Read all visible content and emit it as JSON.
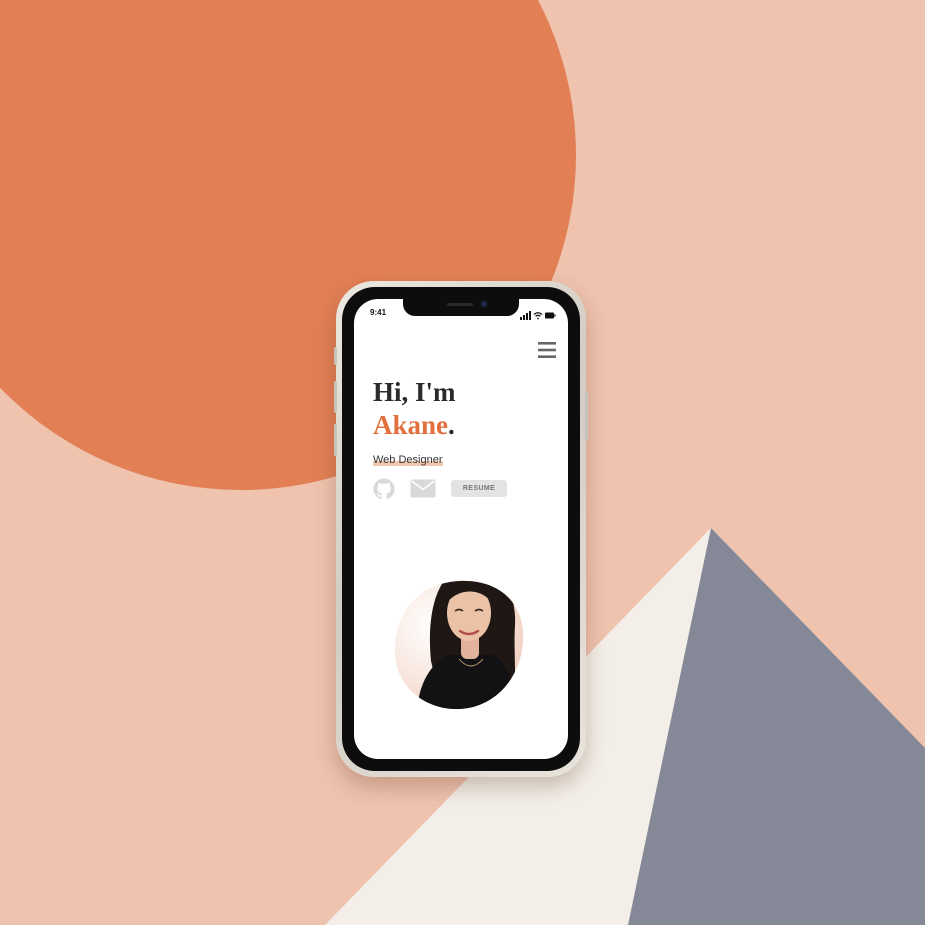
{
  "colors": {
    "background": "#efc3ae",
    "circle": "#e27f55",
    "cream_triangle": "#f3efe8",
    "slate_triangle": "#858896",
    "accent": "#e2703f",
    "heading": "#2b2b2b"
  },
  "status_bar": {
    "time": "9:41"
  },
  "menu": {
    "icon": "hamburger-menu-icon"
  },
  "hero": {
    "greeting": "Hi, I'm",
    "name": "Akane",
    "name_period": ".",
    "role": "Web Designer"
  },
  "links": {
    "github_icon": "github-icon",
    "mail_icon": "mail-icon",
    "resume_label": "RESUME"
  },
  "portrait": {
    "icon": "profile-photo"
  }
}
